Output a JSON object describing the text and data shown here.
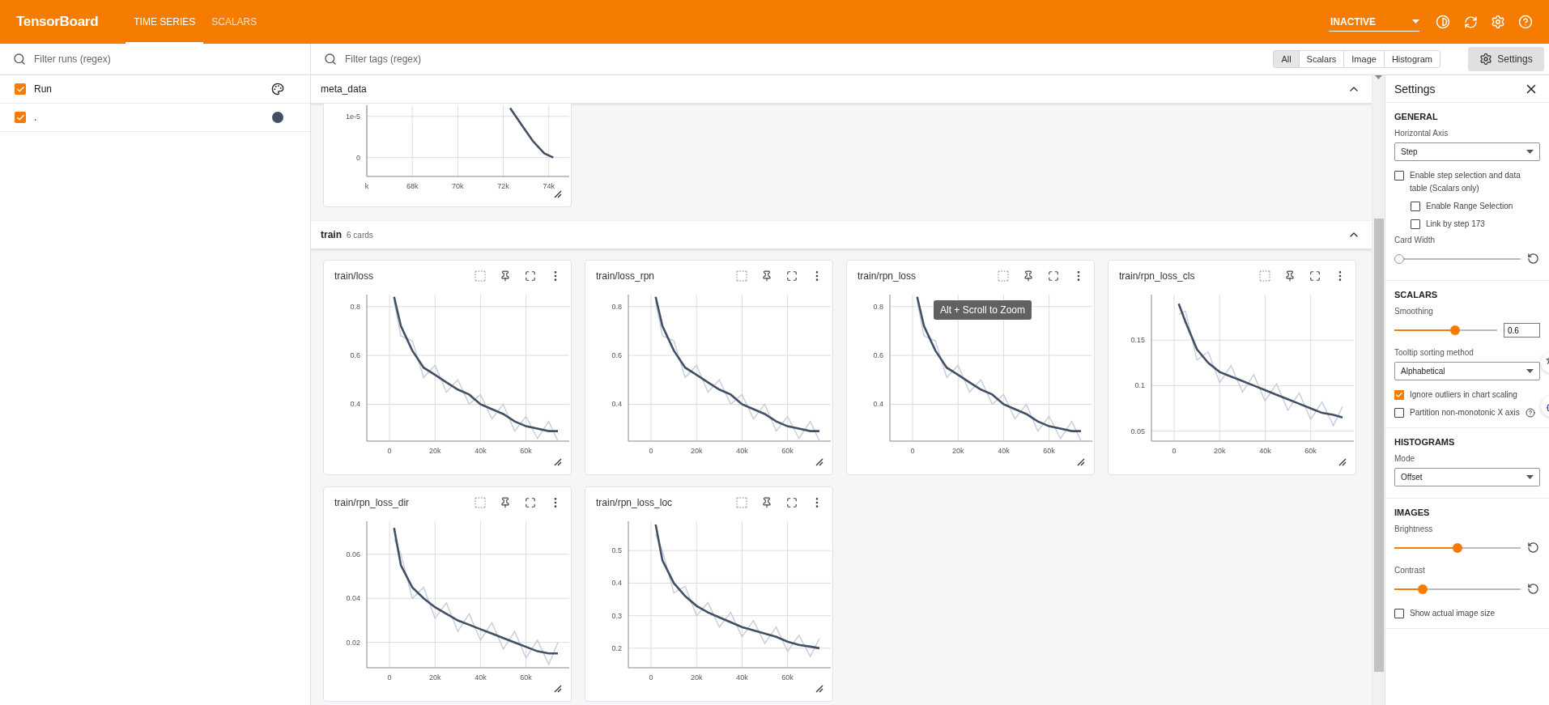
{
  "header": {
    "title": "TensorBoard",
    "tabs": [
      {
        "label": "TIME SERIES",
        "selected": true
      },
      {
        "label": "SCALARS",
        "selected": false
      }
    ],
    "run_state": "INACTIVE"
  },
  "runs_panel": {
    "filter": {
      "placeholder": "Filter runs (regex)"
    },
    "runs": [
      {
        "kind": "all",
        "label": "Run",
        "checked": true
      },
      {
        "kind": "run",
        "label": ".",
        "checked": true,
        "color": "#425066"
      }
    ]
  },
  "toolbar": {
    "filter": {
      "placeholder": "Filter tags (regex)"
    },
    "types": [
      {
        "label": "All",
        "selected": true
      },
      {
        "label": "Scalars",
        "selected": false
      },
      {
        "label": "Image",
        "selected": false
      },
      {
        "label": "Histogram",
        "selected": false
      }
    ],
    "settings_button": {
      "label": "Settings",
      "selected": true
    }
  },
  "groups": [
    {
      "name": "meta_data",
      "expanded": true,
      "cards": [
        {
          "chart_data": {
            "type": "line",
            "grid": true,
            "x": [
              72300,
              72800,
              73300,
              73800,
              74200
            ],
            "series": [
              {
                "color": "#425066",
                "values": [
                  1.2e-05,
                  8e-06,
                  4e-06,
                  1e-06,
                  0
                ]
              }
            ],
            "xlim": [
              66000,
              74900
            ],
            "ylim": [
              -4.6e-06,
              1.27e-05
            ],
            "xticks": [
              {
                "value": 66000,
                "label": "k"
              },
              {
                "value": 68000,
                "label": "68k"
              },
              {
                "value": 70000,
                "label": "70k"
              },
              {
                "value": 72000,
                "label": "72k"
              },
              {
                "value": 74000,
                "label": "74k"
              }
            ],
            "yticks": [
              {
                "value": 0,
                "label": "0"
              },
              {
                "value": 1e-05,
                "label": "1e-5"
              }
            ]
          }
        }
      ]
    },
    {
      "name": "train",
      "count": "6 cards",
      "expanded": true,
      "cards": [
        {
          "title": "train/loss",
          "chart_data": {
            "type": "line",
            "grid": true,
            "x": [
              2000,
              5000,
              10000,
              15000,
              20000,
              25000,
              30000,
              35000,
              40000,
              45000,
              50000,
              55000,
              60000,
              65000,
              70000,
              74000
            ],
            "series": [
              {
                "color": "#c6ccda",
                "values": [
                  0.82,
                  0.68,
                  0.66,
                  0.51,
                  0.56,
                  0.45,
                  0.5,
                  0.4,
                  0.44,
                  0.34,
                  0.4,
                  0.29,
                  0.35,
                  0.26,
                  0.33,
                  0.25
                ]
              },
              {
                "color": "#425066",
                "values": [
                  0.84,
                  0.72,
                  0.62,
                  0.55,
                  0.52,
                  0.49,
                  0.46,
                  0.44,
                  0.4,
                  0.38,
                  0.36,
                  0.33,
                  0.31,
                  0.3,
                  0.29,
                  0.29
                ]
              }
            ],
            "xlim": [
              -10000,
              79000
            ],
            "ylim": [
              0.249,
              0.849
            ],
            "xticks": [
              {
                "value": 0,
                "label": "0"
              },
              {
                "value": 20000,
                "label": "20k"
              },
              {
                "value": 40000,
                "label": "40k"
              },
              {
                "value": 60000,
                "label": "60k"
              }
            ],
            "yticks": [
              0.4,
              0.6,
              0.8
            ]
          }
        },
        {
          "title": "train/loss_rpn",
          "chart_data": {
            "type": "line",
            "grid": true,
            "x": [
              2000,
              5000,
              10000,
              15000,
              20000,
              25000,
              30000,
              35000,
              40000,
              45000,
              50000,
              55000,
              60000,
              65000,
              70000,
              74000
            ],
            "series": [
              {
                "color": "#c6ccda",
                "values": [
                  0.82,
                  0.68,
                  0.66,
                  0.51,
                  0.56,
                  0.45,
                  0.5,
                  0.4,
                  0.44,
                  0.34,
                  0.4,
                  0.29,
                  0.35,
                  0.26,
                  0.33,
                  0.25
                ]
              },
              {
                "color": "#425066",
                "values": [
                  0.84,
                  0.72,
                  0.62,
                  0.55,
                  0.52,
                  0.49,
                  0.46,
                  0.44,
                  0.4,
                  0.38,
                  0.36,
                  0.33,
                  0.31,
                  0.3,
                  0.29,
                  0.29
                ]
              }
            ],
            "xlim": [
              -10000,
              79000
            ],
            "ylim": [
              0.249,
              0.849
            ],
            "xticks": [
              {
                "value": 0,
                "label": "0"
              },
              {
                "value": 20000,
                "label": "20k"
              },
              {
                "value": 40000,
                "label": "40k"
              },
              {
                "value": 60000,
                "label": "60k"
              }
            ],
            "yticks": [
              0.4,
              0.6,
              0.8
            ]
          }
        },
        {
          "title": "train/rpn_loss",
          "tooltip": "Alt + Scroll to Zoom",
          "chart_data": {
            "type": "line",
            "grid": true,
            "x": [
              2000,
              5000,
              10000,
              15000,
              20000,
              25000,
              30000,
              35000,
              40000,
              45000,
              50000,
              55000,
              60000,
              65000,
              70000,
              74000
            ],
            "series": [
              {
                "color": "#c6ccda",
                "values": [
                  0.82,
                  0.68,
                  0.66,
                  0.51,
                  0.56,
                  0.45,
                  0.5,
                  0.4,
                  0.44,
                  0.34,
                  0.4,
                  0.29,
                  0.35,
                  0.26,
                  0.33,
                  0.25
                ]
              },
              {
                "color": "#425066",
                "values": [
                  0.84,
                  0.72,
                  0.62,
                  0.55,
                  0.52,
                  0.49,
                  0.46,
                  0.44,
                  0.4,
                  0.38,
                  0.36,
                  0.33,
                  0.31,
                  0.3,
                  0.29,
                  0.29
                ]
              }
            ],
            "xlim": [
              -10000,
              79000
            ],
            "ylim": [
              0.249,
              0.849
            ],
            "xticks": [
              {
                "value": 0,
                "label": "0"
              },
              {
                "value": 20000,
                "label": "20k"
              },
              {
                "value": 40000,
                "label": "40k"
              },
              {
                "value": 60000,
                "label": "60k"
              }
            ],
            "yticks": [
              0.4,
              0.6,
              0.8
            ]
          }
        },
        {
          "title": "train/rpn_loss_cls",
          "chart_data": {
            "type": "line",
            "grid": true,
            "x": [
              2000,
              5000,
              10000,
              15000,
              20000,
              25000,
              30000,
              35000,
              40000,
              45000,
              50000,
              55000,
              60000,
              65000,
              70000,
              74000
            ],
            "series": [
              {
                "color": "#c6ccda",
                "values": [
                  0.178,
                  0.182,
                  0.128,
                  0.137,
                  0.103,
                  0.122,
                  0.093,
                  0.112,
                  0.083,
                  0.102,
                  0.073,
                  0.092,
                  0.063,
                  0.082,
                  0.056,
                  0.077
                ]
              },
              {
                "color": "#425066",
                "values": [
                  0.19,
                  0.17,
                  0.14,
                  0.125,
                  0.115,
                  0.11,
                  0.105,
                  0.1,
                  0.095,
                  0.09,
                  0.085,
                  0.08,
                  0.075,
                  0.07,
                  0.068,
                  0.065
                ]
              }
            ],
            "xlim": [
              -10000,
              79000
            ],
            "ylim": [
              0.039,
              0.2
            ],
            "xticks": [
              {
                "value": 0,
                "label": "0"
              },
              {
                "value": 20000,
                "label": "20k"
              },
              {
                "value": 40000,
                "label": "40k"
              },
              {
                "value": 60000,
                "label": "60k"
              }
            ],
            "yticks": [
              0.05,
              0.1,
              0.15
            ]
          }
        },
        {
          "title": "train/rpn_loss_dir",
          "chart_data": {
            "type": "line",
            "grid": true,
            "x": [
              2000,
              5000,
              10000,
              15000,
              20000,
              25000,
              30000,
              35000,
              40000,
              45000,
              50000,
              55000,
              60000,
              65000,
              70000,
              74000
            ],
            "series": [
              {
                "color": "#c6ccda",
                "values": [
                  0.067,
                  0.06,
                  0.04,
                  0.045,
                  0.031,
                  0.038,
                  0.025,
                  0.033,
                  0.021,
                  0.029,
                  0.017,
                  0.025,
                  0.013,
                  0.021,
                  0.01,
                  0.02
                ]
              },
              {
                "color": "#425066",
                "values": [
                  0.072,
                  0.055,
                  0.045,
                  0.04,
                  0.036,
                  0.033,
                  0.03,
                  0.028,
                  0.026,
                  0.024,
                  0.022,
                  0.02,
                  0.018,
                  0.016,
                  0.015,
                  0.015
                ]
              }
            ],
            "xlim": [
              -10000,
              79000
            ],
            "ylim": [
              0.0085,
              0.075
            ],
            "xticks": [
              {
                "value": 0,
                "label": "0"
              },
              {
                "value": 20000,
                "label": "20k"
              },
              {
                "value": 40000,
                "label": "40k"
              },
              {
                "value": 60000,
                "label": "60k"
              }
            ],
            "yticks": [
              0.02,
              0.04,
              0.06
            ]
          }
        },
        {
          "title": "train/rpn_loss_loc",
          "chart_data": {
            "type": "line",
            "grid": true,
            "x": [
              2000,
              5000,
              10000,
              15000,
              20000,
              25000,
              30000,
              35000,
              40000,
              45000,
              50000,
              55000,
              60000,
              65000,
              70000,
              74000
            ],
            "series": [
              {
                "color": "#c6ccda",
                "values": [
                  0.55,
                  0.5,
                  0.37,
                  0.39,
                  0.3,
                  0.34,
                  0.265,
                  0.31,
                  0.235,
                  0.285,
                  0.215,
                  0.265,
                  0.19,
                  0.24,
                  0.175,
                  0.23
                ]
              },
              {
                "color": "#425066",
                "values": [
                  0.58,
                  0.47,
                  0.4,
                  0.36,
                  0.33,
                  0.31,
                  0.295,
                  0.28,
                  0.265,
                  0.255,
                  0.245,
                  0.235,
                  0.22,
                  0.21,
                  0.205,
                  0.2
                ]
              }
            ],
            "xlim": [
              -10000,
              79000
            ],
            "ylim": [
              0.14,
              0.59
            ],
            "xticks": [
              {
                "value": 0,
                "label": "0"
              },
              {
                "value": 20000,
                "label": "20k"
              },
              {
                "value": 40000,
                "label": "40k"
              },
              {
                "value": 60000,
                "label": "60k"
              }
            ],
            "yticks": [
              0.2,
              0.3,
              0.4,
              0.5
            ]
          }
        }
      ]
    }
  ],
  "settings": {
    "title": "Settings",
    "sections": [
      {
        "heading": "GENERAL",
        "items": [
          {
            "kind": "select",
            "label": "Horizontal Axis",
            "value": "Step"
          },
          {
            "kind": "checkbox",
            "label": "Enable step selection and data table (Scalars only)",
            "checked": false,
            "children": [
              {
                "label": "Enable Range Selection",
                "checked": false
              },
              {
                "label": "Link by step 173",
                "checked": false
              }
            ]
          },
          {
            "kind": "slider",
            "label": "Card Width",
            "level": 0
          }
        ]
      },
      {
        "heading": "SCALARS",
        "items": [
          {
            "kind": "slider",
            "label": "Smoothing",
            "level": 0.6,
            "value": "0.6"
          },
          {
            "kind": "select",
            "label": "Tooltip sorting method",
            "value": "Alphabetical"
          },
          {
            "kind": "checkbox",
            "label": "Ignore outliers in chart scaling",
            "checked": true
          },
          {
            "kind": "checkbox",
            "label": "Partition non-monotonic X axis",
            "checked": false,
            "help": true
          }
        ]
      },
      {
        "heading": "HISTOGRAMS",
        "items": [
          {
            "kind": "select",
            "label": "Mode",
            "value": "Offset"
          }
        ]
      },
      {
        "heading": "IMAGES",
        "items": [
          {
            "kind": "slider",
            "label": "Brightness",
            "level": 0.5
          },
          {
            "kind": "slider",
            "label": "Contrast",
            "level": 0.2
          },
          {
            "kind": "checkbox",
            "label": "Show actual image size",
            "checked": false
          }
        ]
      }
    ]
  }
}
